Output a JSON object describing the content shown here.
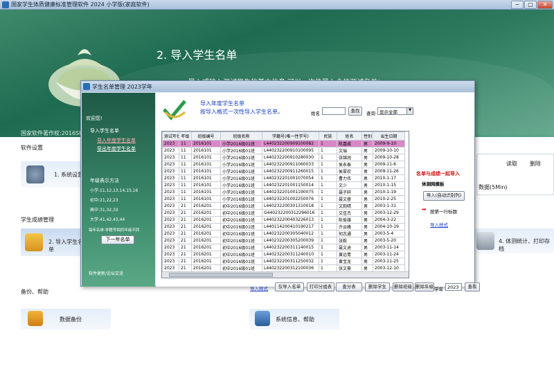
{
  "app": {
    "title": "国家学生体质健康标准管理软件 2024 小学版(家庭软件)",
    "min": "─",
    "max": "□",
    "close": "✕"
  },
  "banner": {
    "heading": "2. 导入学生名单",
    "intro": "导入或输入测试学生的基本信息,可以一次性导入全校测试名单!",
    "copyright": "国家软件著作权:2016SR243480"
  },
  "sections": {
    "settings": "软件设置",
    "scores": "学生成绩管理",
    "backup": "备份、帮助"
  },
  "cards": {
    "system": "1. 系统设置",
    "import": "2. 导入学生名单",
    "stats": "4. 体测统计、打印存档",
    "data_backup": "数据备份",
    "sysinfo": "系统信息、帮助"
  },
  "right_panel": {
    "read": "读取",
    "del": "删除",
    "data5": "数据(5Min)"
  },
  "dialog": {
    "title": "学生名单管理   2023学年",
    "welcome": "欢迎您!",
    "nav_import": "导入学生名单",
    "nav_import_year": "导入年度学生名单",
    "nav_export": "导出年度学生名单",
    "grade_title": "年级表示方法",
    "grades": [
      "小学:11,12,13,14,15,16",
      "初中:21,22,23",
      "高中:31,32,33",
      "大学:41,42,43,44"
    ],
    "grade_note": "每年名单:学籍号相同年级不同",
    "next_year_btn": "下一年名单",
    "update": "软件更新/论坛交流",
    "head1": "导入年度学生名单",
    "head2": "按导入格式一次性导入学生名单。",
    "name_label": "姓名",
    "name_value": "",
    "search_btn": "查找",
    "query_label": "查询",
    "query_value": "显示全部",
    "columns": [
      "测试年份",
      "年级",
      "班级编号",
      "班级名称",
      "学籍号(唯一性学号)",
      "民族",
      "姓名",
      "性别",
      "出生日期"
    ],
    "rows": [
      [
        "2023",
        "11",
        "2016101",
        "小学2016级01班",
        "L440232200909100082",
        "1",
        "陈嘉威",
        "男",
        "2009-9-10"
      ],
      [
        "2023",
        "11",
        "2016101",
        "小学2016级01班",
        "L440232200910100095",
        "1",
        "文瑞",
        "男",
        "2009-10-10"
      ],
      [
        "2023",
        "11",
        "2016101",
        "小学2016级01班",
        "L440232200910280030",
        "1",
        "张锦润",
        "男",
        "2009-10-28"
      ],
      [
        "2023",
        "11",
        "2016101",
        "小学2016级01班",
        "L440232200911060033",
        "1",
        "侯永泰",
        "男",
        "2009-11-6"
      ],
      [
        "2023",
        "11",
        "2016101",
        "小学2016级01班",
        "L440232200911260015",
        "1",
        "侯翠欢",
        "男",
        "2009-11-26"
      ],
      [
        "2023",
        "11",
        "2016101",
        "小学2016级01班",
        "L440232201001070054",
        "1",
        "曹力伟",
        "男",
        "2010-1-17"
      ],
      [
        "2023",
        "11",
        "2016101",
        "小学2016级01班",
        "L440232201001150014",
        "1",
        "文少",
        "男",
        "2010-1-15"
      ],
      [
        "2023",
        "11",
        "2016101",
        "小学2016级01班",
        "L440232201001190075",
        "1",
        "聂子轩",
        "男",
        "2010-1-19"
      ],
      [
        "2023",
        "11",
        "2016101",
        "小学2016级01班",
        "L440232201002250076",
        "1",
        "聂文睿",
        "男",
        "2010-2-25"
      ],
      [
        "2023",
        "21",
        "2016201",
        "初中2016级01班",
        "L440232200301310018",
        "1",
        "文韵晴",
        "男",
        "2003-1-31"
      ],
      [
        "2023",
        "21",
        "2016201",
        "初中2016级01班",
        "G440232200312296016",
        "1",
        "文佳杰",
        "男",
        "2003-12-29"
      ],
      [
        "2023",
        "21",
        "2016201",
        "初中2016级01班",
        "L440232200403226013",
        "1",
        "陈俊雄",
        "男",
        "2004-3-22"
      ],
      [
        "2023",
        "21",
        "2016201",
        "初中2016级01班",
        "L440114200410190217",
        "1",
        "许云峰",
        "男",
        "2004-10-19"
      ],
      [
        "2023",
        "21",
        "2016201",
        "初中2016级01班",
        "L440232200305040012",
        "1",
        "何志通",
        "男",
        "2003-5-4"
      ],
      [
        "2023",
        "21",
        "2016201",
        "初中2016级01班",
        "L440232200305200039",
        "1",
        "张毅",
        "男",
        "2003-5-20"
      ],
      [
        "2023",
        "21",
        "2016201",
        "初中2016级01班",
        "L440232200311140015",
        "1",
        "聂文迪",
        "男",
        "2003-11-14"
      ],
      [
        "2023",
        "21",
        "2016201",
        "初中2016级01班",
        "L440232200311240010",
        "1",
        "黄远青",
        "男",
        "2003-11-24"
      ],
      [
        "2023",
        "21",
        "2016201",
        "初中2016级01班",
        "L440232200311250032",
        "1",
        "黄宝龙",
        "男",
        "2003-11-25"
      ],
      [
        "2023",
        "21",
        "2016201",
        "初中2016级01班",
        "L440232200312100036",
        "1",
        "张文豪",
        "男",
        "2003-12-10"
      ]
    ],
    "right_red": "名单与成绩一起导入",
    "right_sub": "体测网模板",
    "auto_btn": "导入(自动识别列)",
    "right_note": "按第一行标题",
    "right_link": "导入样式",
    "bottom_link": "导入样式",
    "bottom_btns": [
      "仅导入名单",
      "打印分组表",
      "查分表",
      "删除学生",
      "删除班级",
      "删除年级"
    ],
    "year_label": "学年",
    "year_value": "2023",
    "view_btn": "查看"
  }
}
